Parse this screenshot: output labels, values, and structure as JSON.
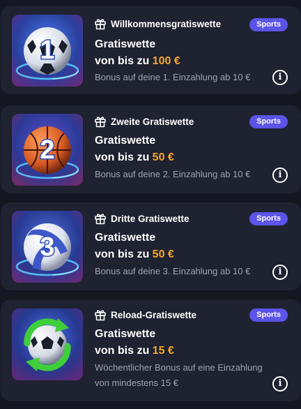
{
  "offers": [
    {
      "title": "Willkommensgratiswette",
      "badge": "Sports",
      "headline_line1": "Gratiswette",
      "headline_prefix": "von bis zu ",
      "amount": "100 €",
      "description_lines": [
        "Bonus auf deine 1. Einzahlung ab 10 €"
      ],
      "image": "soccer-ball-number-1",
      "gift_icon": "gift-icon",
      "info_icon": "info-icon"
    },
    {
      "title": "Zweite Gratiswette",
      "badge": "Sports",
      "headline_line1": "Gratiswette",
      "headline_prefix": "von bis zu ",
      "amount": "50 €",
      "description_lines": [
        "Bonus auf deine 2. Einzahlung ab 10 €"
      ],
      "image": "basketball-number-2",
      "gift_icon": "gift-icon",
      "info_icon": "info-icon"
    },
    {
      "title": "Dritte Gratiswette",
      "badge": "Sports",
      "headline_line1": "Gratiswette",
      "headline_prefix": "von bis zu ",
      "amount": "50 €",
      "description_lines": [
        "Bonus auf deine 3. Einzahlung ab 10 €"
      ],
      "image": "volleyball-number-3",
      "gift_icon": "gift-icon",
      "info_icon": "info-icon"
    },
    {
      "title": "Reload-Gratiswette",
      "badge": "Sports",
      "headline_line1": "Gratiswette",
      "headline_prefix": "von bis zu ",
      "amount": "15 €",
      "description_lines": [
        "Wöchentlicher Bonus auf eine Einzahlung",
        "von mindestens 15 €"
      ],
      "image": "soccer-ball-reload-arrows",
      "gift_icon": "gift-icon",
      "info_icon": "info-icon"
    }
  ],
  "info_glyph": "i",
  "colors": {
    "background": "#141722",
    "card": "#1f2230",
    "badge": "#5b54e6",
    "amount": "#f5a62a",
    "muted_text": "#9ea3b5"
  }
}
